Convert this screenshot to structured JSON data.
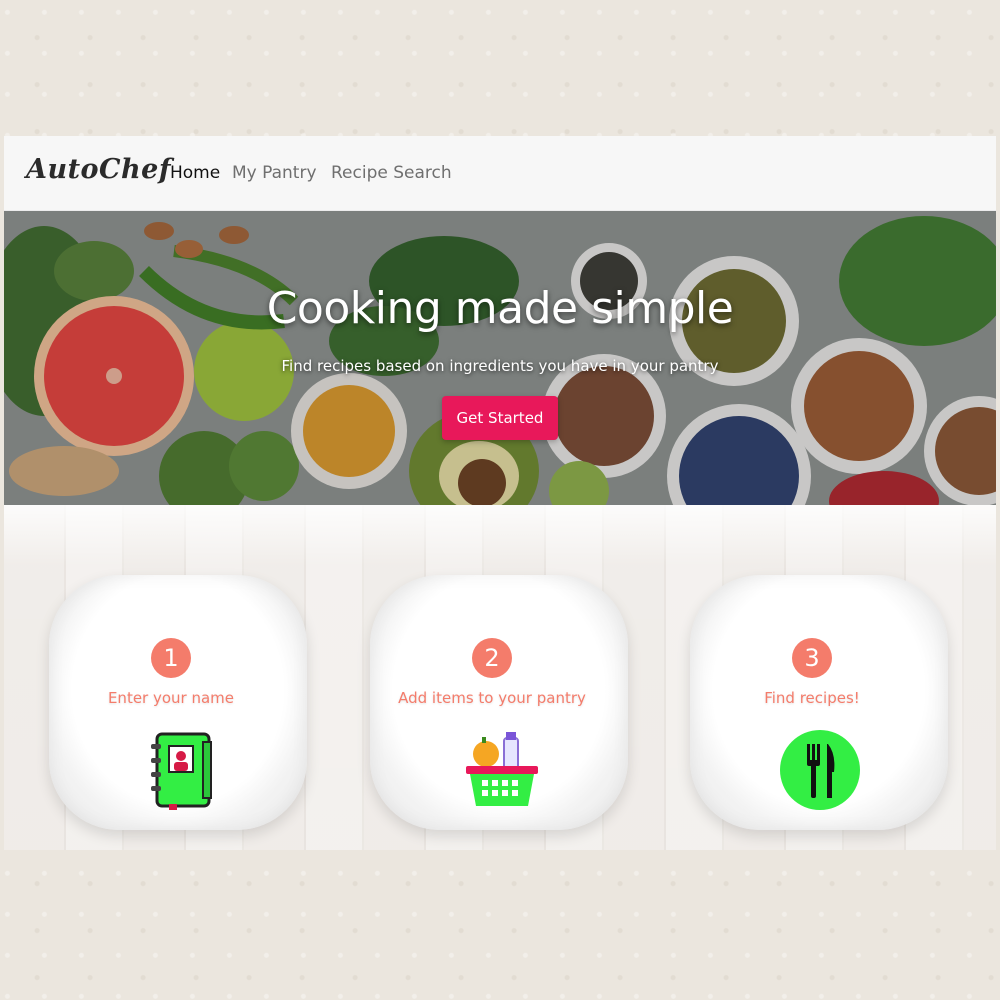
{
  "nav": {
    "brand": "AutoChef",
    "links": [
      {
        "label": "Home",
        "active": true
      },
      {
        "label": "My Pantry",
        "active": false
      },
      {
        "label": "Recipe Search",
        "active": false
      }
    ]
  },
  "hero": {
    "title": "Cooking made simple",
    "subtitle": "Find recipes based on ingredients you have in your pantry",
    "cta_label": "Get Started"
  },
  "steps": [
    {
      "number": "1",
      "label": "Enter your name",
      "icon": "address-book-icon"
    },
    {
      "number": "2",
      "label": "Add items to your pantry",
      "icon": "grocery-basket-icon"
    },
    {
      "number": "3",
      "label": "Find recipes!",
      "icon": "fork-knife-icon"
    }
  ],
  "colors": {
    "accent": "#e8185a",
    "step_coral": "#f47c6b",
    "icon_green": "#33ee44"
  }
}
